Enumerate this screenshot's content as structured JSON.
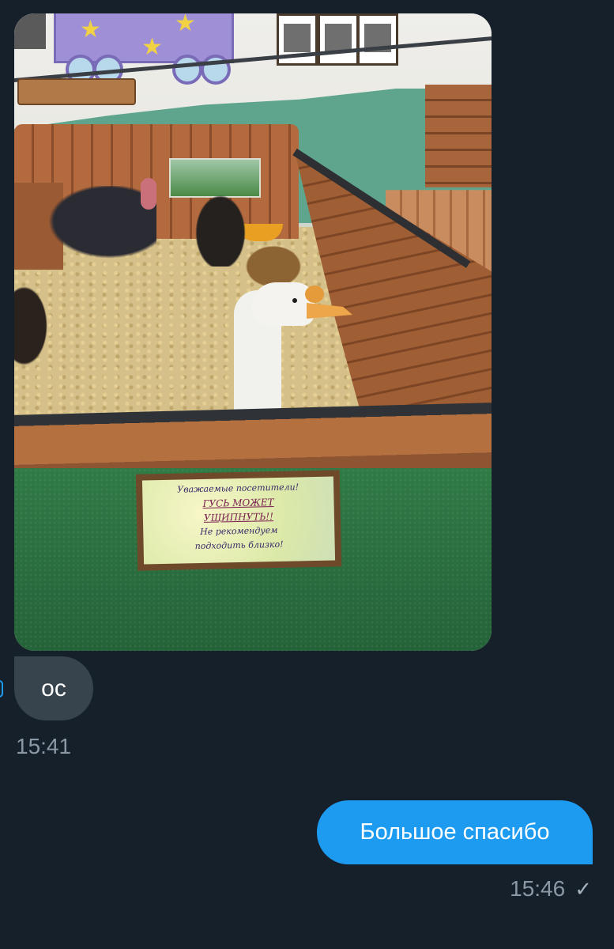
{
  "messages": [
    {
      "direction": "received",
      "type": "photo",
      "sign": {
        "line1": "Уважаемые посетители!",
        "line2": "ГУСЬ МОЖЕТ",
        "line3": "УЩИПНУТЬ!!",
        "line4": "Не рекомендуем",
        "line5": "подходить близко!"
      }
    },
    {
      "direction": "received",
      "type": "text",
      "text": "ос",
      "time": "15:41"
    },
    {
      "direction": "sent",
      "type": "text",
      "text": "Большое спасибо",
      "time": "15:46",
      "status_icon": "check-icon"
    }
  ],
  "colors": {
    "background": "#15202b",
    "received_bubble": "#38444d",
    "sent_bubble": "#1d9bf0",
    "meta_text": "#8b98a5"
  }
}
